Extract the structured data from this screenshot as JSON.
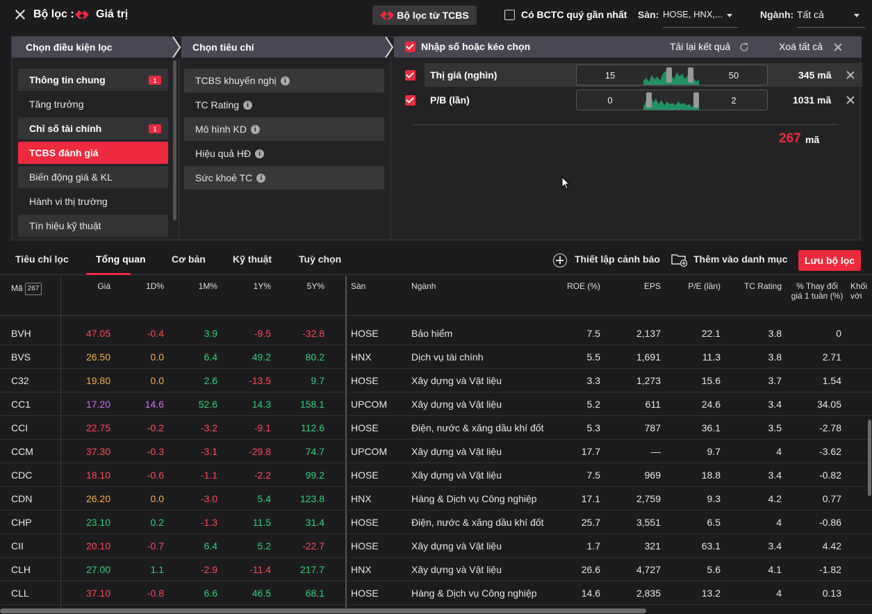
{
  "header": {
    "title": "Bộ lọc :",
    "subtitle": "Giá trị",
    "tcbs_button": "Bộ lọc từ TCBS",
    "bctc_label": "Có BCTC quý gần nhất",
    "san_label": "Sàn:",
    "san_value": "HOSE, HNX,...",
    "nganh_label": "Ngành:",
    "nganh_value": "Tất cả"
  },
  "panel": {
    "col1_title": "Chọn điều kiện lọc",
    "col2_title": "Chọn tiêu chí",
    "col3_title": "Nhập số hoặc kéo chọn",
    "reload_label": "Tải lại kết quả",
    "clear_all_label": "Xoá tất cả",
    "categories": [
      {
        "label": "Thông tin chung",
        "badge": "1"
      },
      {
        "label": "Tăng trưởng",
        "badge": ""
      },
      {
        "label": "Chỉ số tài chính",
        "badge": "1"
      },
      {
        "label": "TCBS đánh giá",
        "badge": ""
      },
      {
        "label": "Biến động giá & KL",
        "badge": ""
      },
      {
        "label": "Hành vi thị trường",
        "badge": ""
      },
      {
        "label": "Tín hiệu kỹ thuật",
        "badge": ""
      }
    ],
    "criteria": [
      {
        "label": "TCBS khuyến nghị",
        "info": "i"
      },
      {
        "label": "TC Rating",
        "info": "i"
      },
      {
        "label": "Mô hình KD",
        "info": "i"
      },
      {
        "label": "Hiệu quả HĐ",
        "info": "i"
      },
      {
        "label": "Sức khoẻ TC",
        "info": "i"
      }
    ],
    "filters": [
      {
        "label": "Thị giá (nghìn)",
        "min": "15",
        "max": "50",
        "count": "345 mã"
      },
      {
        "label": "P/B (lần)",
        "min": "0",
        "max": "2",
        "count": "1031 mã"
      }
    ],
    "total_count": "267",
    "total_unit": "mã"
  },
  "tabs": {
    "items": [
      "Tiêu chí lọc",
      "Tổng quan",
      "Cơ bản",
      "Kỹ thuật",
      "Tuỳ chọn"
    ],
    "active": "Tổng quan",
    "alert_label": "Thiết lập cảnh báo",
    "watchlist_label": "Thêm vào danh mục",
    "save_label": "Lưu bộ lọc"
  },
  "table": {
    "headers": {
      "ma": "Mã",
      "ma_count": "267",
      "gia": "Giá",
      "d1": "1D%",
      "m1": "1M%",
      "y1": "1Y%",
      "y5": "5Y%",
      "san": "Sàn",
      "nganh": "Ngành",
      "roe": "ROE (%)",
      "eps": "EPS",
      "pe": "P/E (lần)",
      "tcr": "TC Rating",
      "chg_line1": "% Thay đổi",
      "chg_line2": "giá 1 tuần (%)",
      "extra_line1": "Khối",
      "extra_line2": "với"
    },
    "rows": [
      {
        "ma": "BVH",
        "gia": "47.05",
        "d1": "-0.4",
        "m1": "3.9",
        "y1": "-9.5",
        "y5": "-32.8",
        "san": "HOSE",
        "nganh": "Bảo hiểm",
        "roe": "7.5",
        "eps": "2,137",
        "pe": "22.1",
        "tcr": "3.8",
        "chg": "0"
      },
      {
        "ma": "BVS",
        "gia": "26.50",
        "d1": "0.0",
        "m1": "6.4",
        "y1": "49.2",
        "y5": "80.2",
        "san": "HNX",
        "nganh": "Dịch vụ tài chính",
        "roe": "5.5",
        "eps": "1,691",
        "pe": "11.3",
        "tcr": "3.8",
        "chg": "2.71"
      },
      {
        "ma": "C32",
        "gia": "19.80",
        "d1": "0.0",
        "m1": "2.6",
        "y1": "-13.5",
        "y5": "9.7",
        "san": "HOSE",
        "nganh": "Xây dựng và Vật liệu",
        "roe": "3.3",
        "eps": "1,273",
        "pe": "15.6",
        "tcr": "3.7",
        "chg": "1.54"
      },
      {
        "ma": "CC1",
        "gia": "17.20",
        "d1": "14.6",
        "m1": "52.6",
        "y1": "14.3",
        "y5": "158.1",
        "san": "UPCOM",
        "nganh": "Xây dựng và Vật liệu",
        "roe": "5.2",
        "eps": "611",
        "pe": "24.6",
        "tcr": "3.4",
        "chg": "34.05"
      },
      {
        "ma": "CCI",
        "gia": "22.75",
        "d1": "-0.2",
        "m1": "-3.2",
        "y1": "-9.1",
        "y5": "112.6",
        "san": "HOSE",
        "nganh": "Điện, nước & xăng dầu khí đốt",
        "roe": "5.3",
        "eps": "787",
        "pe": "36.1",
        "tcr": "3.5",
        "chg": "-2.78"
      },
      {
        "ma": "CCM",
        "gia": "37.30",
        "d1": "-0.3",
        "m1": "-3.1",
        "y1": "-29.8",
        "y5": "74.7",
        "san": "UPCOM",
        "nganh": "Xây dựng và Vật liệu",
        "roe": "17.7",
        "eps": "—",
        "pe": "9.7",
        "tcr": "4",
        "chg": "-3.62"
      },
      {
        "ma": "CDC",
        "gia": "18.10",
        "d1": "-0.6",
        "m1": "-1.1",
        "y1": "-2.2",
        "y5": "99.2",
        "san": "HOSE",
        "nganh": "Xây dựng và Vật liệu",
        "roe": "7.5",
        "eps": "969",
        "pe": "18.8",
        "tcr": "3.4",
        "chg": "-0.82"
      },
      {
        "ma": "CDN",
        "gia": "26.20",
        "d1": "0.0",
        "m1": "-3.0",
        "y1": "5.4",
        "y5": "123.8",
        "san": "HNX",
        "nganh": "Hàng & Dịch vụ Công nghiệp",
        "roe": "17.1",
        "eps": "2,759",
        "pe": "9.3",
        "tcr": "4.2",
        "chg": "0.77"
      },
      {
        "ma": "CHP",
        "gia": "23.10",
        "d1": "0.2",
        "m1": "-1.3",
        "y1": "11.5",
        "y5": "31.4",
        "san": "HOSE",
        "nganh": "Điện, nước & xăng dầu khí đốt",
        "roe": "25.7",
        "eps": "3,551",
        "pe": "6.5",
        "tcr": "4",
        "chg": "-0.86"
      },
      {
        "ma": "CII",
        "gia": "20.10",
        "d1": "-0.7",
        "m1": "6.4",
        "y1": "5.2",
        "y5": "-22.7",
        "san": "HOSE",
        "nganh": "Xây dựng và Vật liệu",
        "roe": "1.7",
        "eps": "321",
        "pe": "63.1",
        "tcr": "3.4",
        "chg": "4.42"
      },
      {
        "ma": "CLH",
        "gia": "27.00",
        "d1": "1.1",
        "m1": "-2.9",
        "y1": "-11.4",
        "y5": "217.7",
        "san": "HNX",
        "nganh": "Xây dựng và Vật liệu",
        "roe": "26.6",
        "eps": "4,727",
        "pe": "5.6",
        "tcr": "4.1",
        "chg": "-1.82"
      },
      {
        "ma": "CLL",
        "gia": "37.10",
        "d1": "-0.8",
        "m1": "6.6",
        "y1": "46.5",
        "y5": "68.1",
        "san": "HOSE",
        "nganh": "Hàng & Dịch vụ Công nghiệp",
        "roe": "14.6",
        "eps": "2,835",
        "pe": "13.2",
        "tcr": "4",
        "chg": "0.13"
      }
    ]
  },
  "colors": {
    "accent": "#ee2a3f",
    "price_up": "#2ed47a",
    "price_down": "#ff4a5a",
    "price_ref": "#f5b041",
    "price_ceiling": "#d36cf0",
    "price_floor": "#4fc3f7"
  }
}
